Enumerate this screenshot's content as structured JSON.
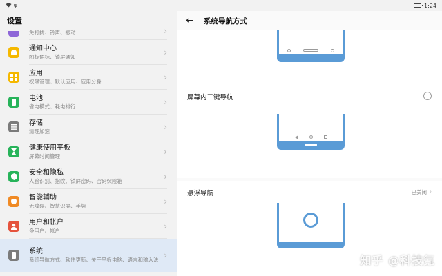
{
  "status_bar": {
    "time": "1:24"
  },
  "left": {
    "title": "设置",
    "items": [
      {
        "title": "",
        "subtitle": "免打扰、铃声、振动",
        "icon": "sound-icon",
        "color": "#8e67d8"
      },
      {
        "title": "通知中心",
        "subtitle": "图标角标、锁屏通知",
        "icon": "bell-icon",
        "color": "#f5b800"
      },
      {
        "title": "应用",
        "subtitle": "权限管理、默认应用、应用分身",
        "icon": "apps-icon",
        "color": "#f5b800"
      },
      {
        "title": "电池",
        "subtitle": "省电模式、耗电排行",
        "icon": "battery-icon",
        "color": "#27b35a"
      },
      {
        "title": "存储",
        "subtitle": "清理加速",
        "icon": "storage-icon",
        "color": "#7b7b7b"
      },
      {
        "title": "健康使用平板",
        "subtitle": "屏幕时间管理",
        "icon": "hourglass-icon",
        "color": "#27b35a"
      },
      {
        "title": "安全和隐私",
        "subtitle": "人脸识别、指纹、锁屏密码、密码保险箱",
        "icon": "shield-icon",
        "color": "#27b35a"
      },
      {
        "title": "智能辅助",
        "subtitle": "无障碍、智慧识屏、手势",
        "icon": "hand-icon",
        "color": "#f08a24"
      },
      {
        "title": "用户和帐户",
        "subtitle": "多用户、帐户",
        "icon": "user-icon",
        "color": "#e5533d"
      },
      {
        "title": "系统",
        "subtitle": "系统导航方式、软件更新、关于平板电脑、语言和输入法",
        "icon": "system-icon",
        "color": "#7b7b7b"
      }
    ]
  },
  "right": {
    "title": "系统导航方式",
    "options": [
      {
        "label": "屏幕内三键导航"
      },
      {
        "label": "悬浮导航",
        "status": "已关闭"
      }
    ]
  },
  "watermark": "知乎 @科技氪",
  "colors": {
    "accent": "#5a9bd6",
    "selected_bg": "#dfe9f6"
  }
}
